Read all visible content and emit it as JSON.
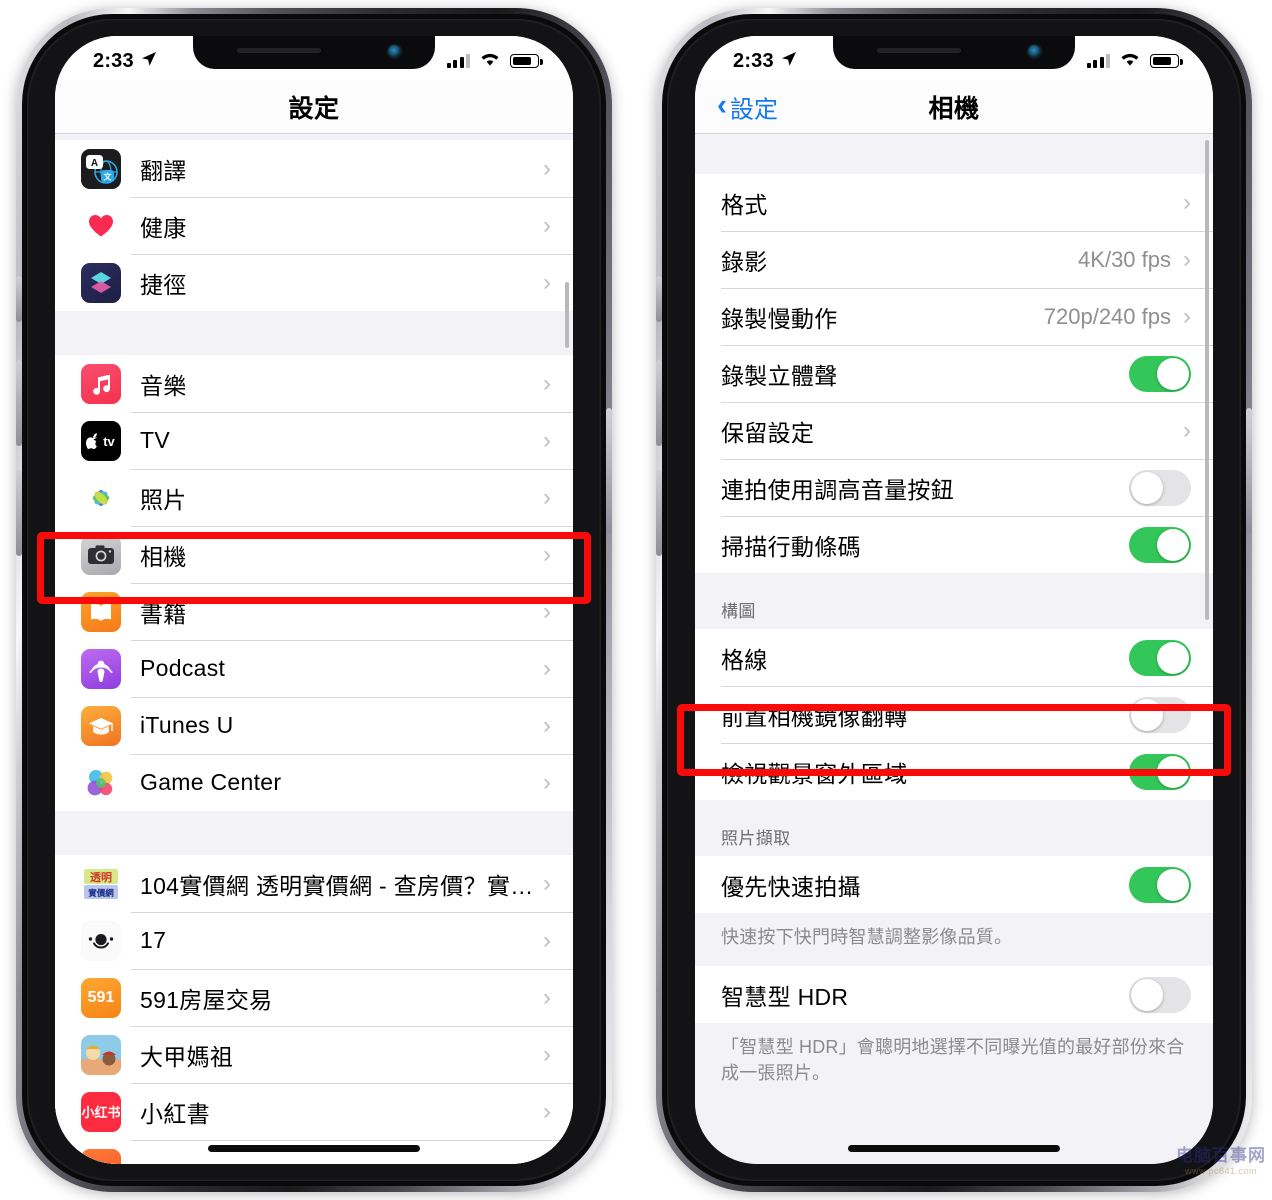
{
  "left_phone": {
    "status_bar": {
      "time": "2:33",
      "location_icon": "location-arrow-icon",
      "signal_icon": "cellular-bars-icon",
      "wifi_icon": "wifi-icon",
      "battery_icon": "battery-icon"
    },
    "nav": {
      "title": "設定"
    },
    "groups": [
      {
        "rows": [
          {
            "icon": "translate-app-icon",
            "label": "翻譯",
            "accessory": "chevron"
          },
          {
            "icon": "health-app-icon",
            "label": "健康",
            "accessory": "chevron"
          },
          {
            "icon": "shortcuts-app-icon",
            "label": "捷徑",
            "accessory": "chevron"
          }
        ]
      },
      {
        "rows": [
          {
            "icon": "music-app-icon",
            "label": "音樂",
            "accessory": "chevron"
          },
          {
            "icon": "tv-app-icon",
            "label": "TV",
            "accessory": "chevron"
          },
          {
            "icon": "photos-app-icon",
            "label": "照片",
            "accessory": "chevron"
          },
          {
            "icon": "camera-app-icon",
            "label": "相機",
            "accessory": "chevron",
            "highlighted": true
          },
          {
            "icon": "books-app-icon",
            "label": "書籍",
            "accessory": "chevron"
          },
          {
            "icon": "podcast-app-icon",
            "label": "Podcast",
            "accessory": "chevron"
          },
          {
            "icon": "itunesu-app-icon",
            "label": "iTunes U",
            "accessory": "chevron"
          },
          {
            "icon": "gamecenter-app-icon",
            "label": "Game Center",
            "accessory": "chevron"
          }
        ]
      },
      {
        "rows": [
          {
            "icon": "app104-icon",
            "label": "104實價網 透明實價網 - 查房價？實…",
            "accessory": "chevron"
          },
          {
            "icon": "app17-icon",
            "label": "17",
            "accessory": "chevron"
          },
          {
            "icon": "app591-icon",
            "label": "591房屋交易",
            "accessory": "chevron"
          },
          {
            "icon": "mazu-app-icon",
            "label": "大甲媽祖",
            "accessory": "chevron"
          },
          {
            "icon": "xiaohongshu-app-icon",
            "label": "小紅書",
            "accessory": "chevron"
          }
        ]
      }
    ]
  },
  "right_phone": {
    "status_bar": {
      "time": "2:33",
      "location_icon": "location-arrow-icon",
      "signal_icon": "cellular-bars-icon",
      "wifi_icon": "wifi-icon",
      "battery_icon": "battery-icon"
    },
    "nav": {
      "back_label": "設定",
      "title": "相機"
    },
    "sections": [
      {
        "header": "",
        "footer": "",
        "rows": [
          {
            "label": "格式",
            "accessory": "chevron"
          },
          {
            "label": "錄影",
            "value": "4K/30 fps",
            "accessory": "chevron"
          },
          {
            "label": "錄製慢動作",
            "value": "720p/240 fps",
            "accessory": "chevron"
          },
          {
            "label": "錄製立體聲",
            "accessory": "toggle",
            "toggle": "on"
          },
          {
            "label": "保留設定",
            "accessory": "chevron"
          },
          {
            "label": "連拍使用調高音量按鈕",
            "accessory": "toggle",
            "toggle": "off"
          },
          {
            "label": "掃描行動條碼",
            "accessory": "toggle",
            "toggle": "on"
          }
        ]
      },
      {
        "header": "構圖",
        "footer": "",
        "rows": [
          {
            "label": "格線",
            "accessory": "toggle",
            "toggle": "on"
          },
          {
            "label": "前置相機鏡像翻轉",
            "accessory": "toggle",
            "toggle": "off",
            "highlighted": true
          },
          {
            "label": "檢視觀景窗外區域",
            "accessory": "toggle",
            "toggle": "on"
          }
        ]
      },
      {
        "header": "照片擷取",
        "footer": "快速按下快門時智慧調整影像品質。",
        "rows": [
          {
            "label": "優先快速拍攝",
            "accessory": "toggle",
            "toggle": "on"
          }
        ]
      },
      {
        "header": "",
        "footer": "「智慧型 HDR」會聰明地選擇不同曝光值的最好部份來合成一張照片。",
        "rows": [
          {
            "label": "智慧型 HDR",
            "accessory": "toggle",
            "toggle": "off"
          }
        ]
      }
    ]
  },
  "annotations": {
    "highlight_color": "#fa0a09",
    "left_highlight_target": "相機",
    "right_highlight_target": "前置相機鏡像翻轉"
  },
  "watermark": {
    "line1": "电脑百事网",
    "line2": "www.pc841.com"
  }
}
